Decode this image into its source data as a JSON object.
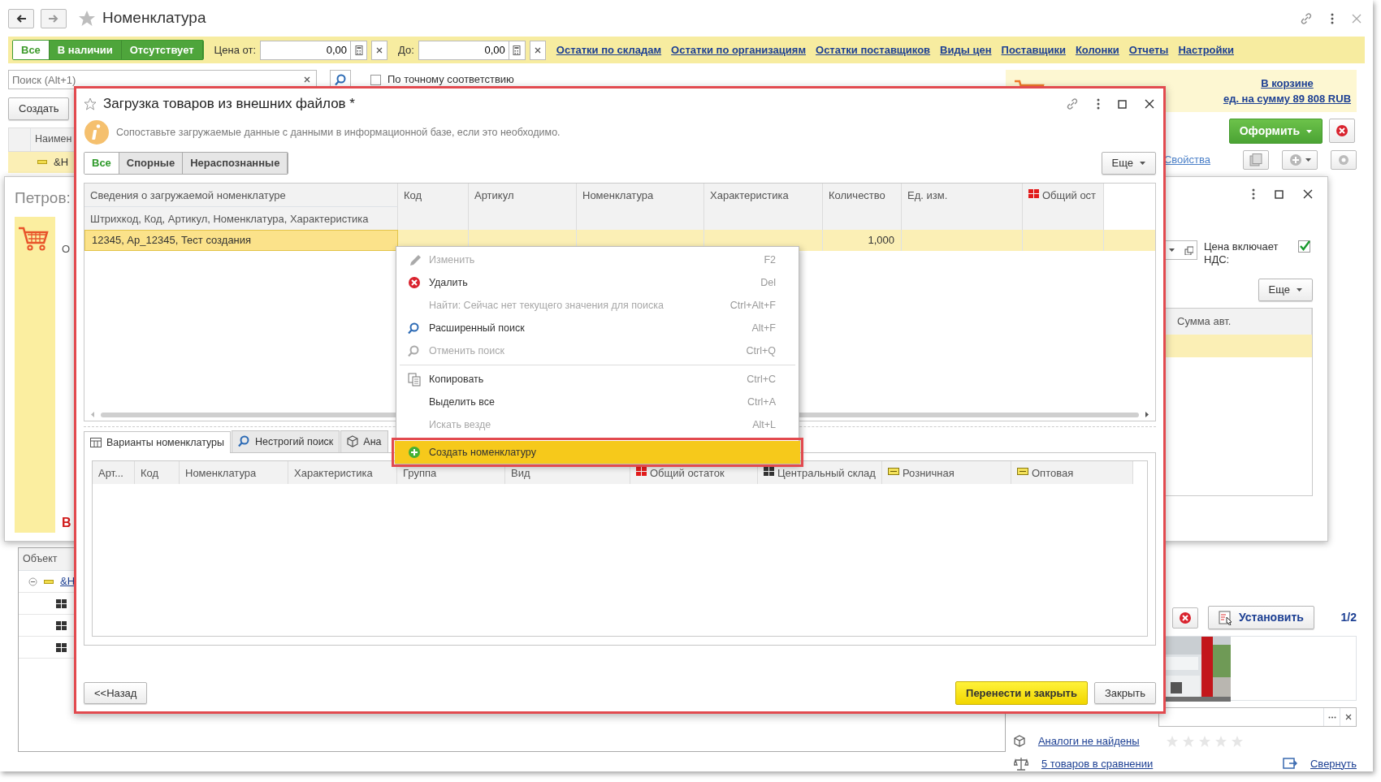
{
  "window": {
    "title": "Номенклатура"
  },
  "filter_bar": {
    "tabs": [
      {
        "label": "Все",
        "selected": true
      },
      {
        "label": "В наличии",
        "selected": false
      },
      {
        "label": "Отсутствует",
        "selected": false
      }
    ],
    "price_from": {
      "label": "Цена от:",
      "value": "0,00"
    },
    "price_to": {
      "label": "До:",
      "value": "0,00"
    },
    "links": [
      "Остатки по складам",
      "Остатки по организациям",
      "Остатки поставщиков",
      "Виды цен",
      "Поставщики",
      "Колонки",
      "Отчеты",
      "Настройки"
    ]
  },
  "search": {
    "placeholder": "Поиск (Alt+1)",
    "exact_match": {
      "label": "По точному соответствию",
      "checked": false
    }
  },
  "create_button": "Создать",
  "list": {
    "columns": [
      "Наимен"
    ],
    "rows": [
      {
        "text": "&Н",
        "selected": true
      }
    ]
  },
  "tree": {
    "columns": [
      "Объект"
    ],
    "rows": [
      {
        "text": "&Н",
        "expanded": true,
        "children": [
          {
            "kind": "grid"
          },
          {
            "kind": "grid"
          },
          {
            "kind": "grid"
          }
        ]
      }
    ]
  },
  "cart": {
    "link": "В корзине",
    "total": "ед. на сумму 89 808 RUB"
  },
  "checkout_button": "Оформить",
  "properties_link": "Свойства",
  "card": {
    "set_button": "Установить",
    "pager": "1/2",
    "analogs_link": "Аналоги не найдены",
    "stars": 0,
    "compare_link": "5 товаров в сравнении",
    "collapse_link": "Свернуть"
  },
  "back_dialog": {
    "title": "Петров:",
    "field_label": "О",
    "warning": "В",
    "vat": {
      "label": "Цена включает НДС:",
      "checked": true
    },
    "more_button": "Еще",
    "columns": [
      "Сумма авт."
    ]
  },
  "dialog": {
    "title": "Загрузка товаров из внешних файлов *",
    "message": "Сопоставьте загружаемые данные с данными в информационной базе, если это необходимо.",
    "filters": [
      {
        "label": "Все",
        "selected": true
      },
      {
        "label": "Спорные",
        "selected": false
      },
      {
        "label": "Нераспознанные",
        "selected": false
      }
    ],
    "more_button": "Еще",
    "table": {
      "header_title": "Сведения о загружаемой номенклатуре",
      "header_subtitle": "Штрихкод, Код, Артикул, Номенклатура, Характеристика",
      "columns": [
        {
          "label": "Код",
          "kind": "plain"
        },
        {
          "label": "Артикул",
          "kind": "plain"
        },
        {
          "label": "Номенклатура",
          "kind": "plain"
        },
        {
          "label": "Характеристика",
          "kind": "plain"
        },
        {
          "label": "Количество",
          "kind": "plain"
        },
        {
          "label": "Ед. изм.",
          "kind": "plain"
        },
        {
          "label": "Общий ост",
          "kind": "stock_total"
        }
      ],
      "rows": [
        {
          "info": "12345, Ар_12345, Тест создания",
          "quantity": "1,000",
          "selected": true
        }
      ]
    },
    "tabs": [
      {
        "label": "Варианты номенклатуры",
        "kind": "table",
        "selected": true
      },
      {
        "label": "Нестрогий поиск",
        "kind": "search",
        "selected": false
      },
      {
        "label": "Ана",
        "kind": "cube",
        "selected": false
      }
    ],
    "variants_table": {
      "columns": [
        {
          "label": "Арт...",
          "kind": "plain"
        },
        {
          "label": "Код",
          "kind": "plain"
        },
        {
          "label": "Номенклатура",
          "kind": "plain"
        },
        {
          "label": "Характеристика",
          "kind": "plain"
        },
        {
          "label": "Группа",
          "kind": "plain"
        },
        {
          "label": "Вид",
          "kind": "plain"
        },
        {
          "label": "Общий остаток",
          "kind": "stock_total"
        },
        {
          "label": "Центральный склад",
          "kind": "warehouse"
        },
        {
          "label": "Розничная",
          "kind": "price"
        },
        {
          "label": "Оптовая",
          "kind": "price"
        }
      ]
    },
    "back_button": "<<Назад",
    "transfer_button": "Перенести и закрыть",
    "close_button": "Закрыть"
  },
  "context_menu": {
    "items": [
      {
        "kind": "pencil",
        "label": "Изменить",
        "shortcut": "F2",
        "disabled": true,
        "selected": false
      },
      {
        "kind": "delete",
        "label": "Удалить",
        "shortcut": "Del",
        "disabled": false,
        "selected": false
      },
      {
        "kind": "none",
        "label": "Найти: Сейчас нет текущего значения для поиска",
        "shortcut": "Ctrl+Alt+F",
        "disabled": true,
        "selected": false
      },
      {
        "kind": "search",
        "label": "Расширенный поиск",
        "shortcut": "Alt+F",
        "disabled": false,
        "selected": false
      },
      {
        "kind": "search_cancel",
        "label": "Отменить поиск",
        "shortcut": "Ctrl+Q",
        "disabled": true,
        "selected": false
      },
      {
        "kind": "separator"
      },
      {
        "kind": "copy",
        "label": "Копировать",
        "shortcut": "Ctrl+C",
        "disabled": false,
        "selected": false
      },
      {
        "kind": "none",
        "label": "Выделить все",
        "shortcut": "Ctrl+A",
        "disabled": false,
        "selected": false
      },
      {
        "kind": "none",
        "label": "Искать везде",
        "shortcut": "Alt+L",
        "disabled": true,
        "selected": false
      },
      {
        "kind": "plus",
        "label": "Создать номенклатуру",
        "disabled": false,
        "selected": true
      }
    ]
  }
}
